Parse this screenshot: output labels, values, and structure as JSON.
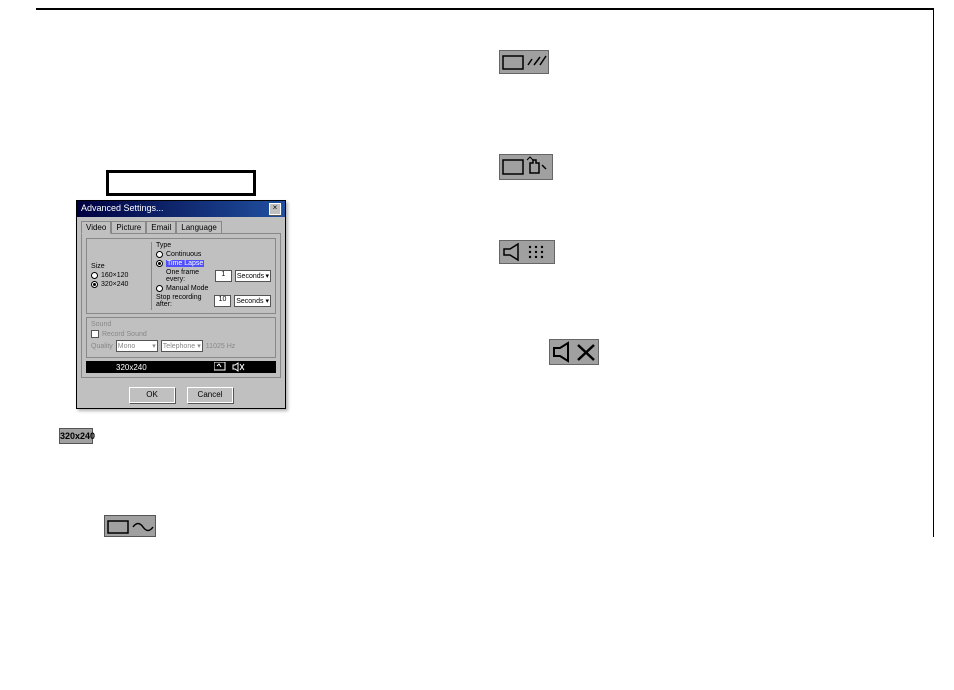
{
  "dialog": {
    "title": "Advanced Settings...",
    "tabs": [
      "Video",
      "Picture",
      "Email",
      "Language"
    ],
    "size_legend": "Size",
    "size_options": [
      "160×120",
      "320×240"
    ],
    "type_legend": "Type",
    "type_options": {
      "continuous": "Continuous",
      "time_lapse": "Time Lapse",
      "one_frame_every": "One frame every:",
      "manual_mode": "Manual Mode"
    },
    "frame_value": "1",
    "frame_unit": "Seconds",
    "stop_label": "Stop recording after:",
    "stop_value": "10",
    "stop_unit": "Seconds",
    "sound_legend": "Sound",
    "record_sound": "Record Sound",
    "quality_label": "Quality",
    "quality_mono": "Mono",
    "quality_tele": "Telephone",
    "quality_hz": "11025 Hz",
    "status_text": "320x240",
    "ok": "OK",
    "cancel": "Cancel"
  },
  "badge_320": "320x240"
}
